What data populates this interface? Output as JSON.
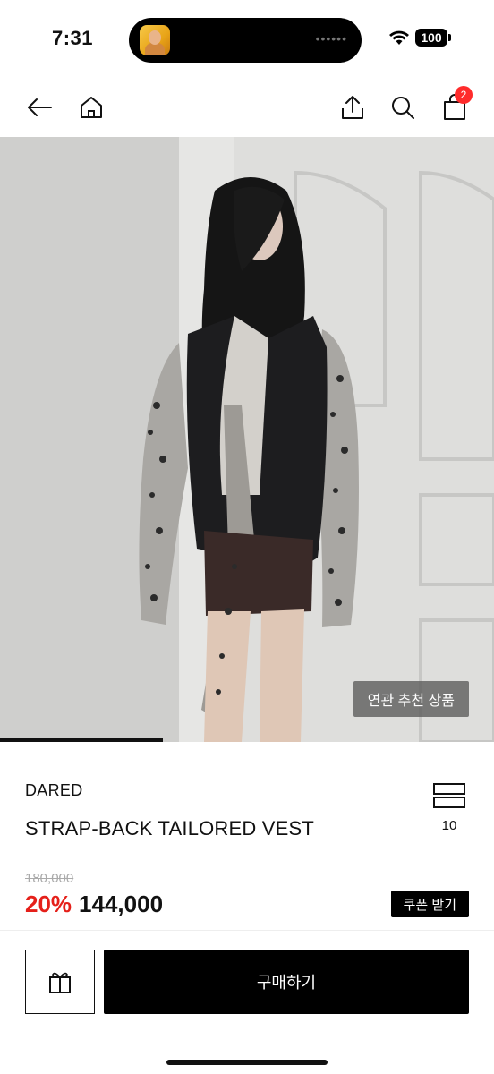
{
  "status_bar": {
    "time": "7:31",
    "battery": "100",
    "island_dots": "••••••",
    "icons": [
      "app-avatar-icon",
      "wifi-icon",
      "battery-icon"
    ]
  },
  "nav": {
    "cart_count": "2",
    "icons": [
      "back-arrow-icon",
      "home-icon",
      "share-icon",
      "search-icon",
      "bag-icon"
    ]
  },
  "hero": {
    "related_label": "연관 추천 상품",
    "progress": 0.33
  },
  "product": {
    "brand": "DARED",
    "name": "STRAP-BACK TAILORED VEST",
    "like_count": "10",
    "original_price": "180,000",
    "discount": "20%",
    "price": "144,000",
    "coupon_label": "쿠폰 받기"
  },
  "bottom": {
    "buy_label": "구매하기",
    "icons": [
      "gift-icon"
    ]
  },
  "colors": {
    "accent_red": "#e5201a",
    "badge_red": "#ff2b2b",
    "primary_black": "#000000"
  }
}
